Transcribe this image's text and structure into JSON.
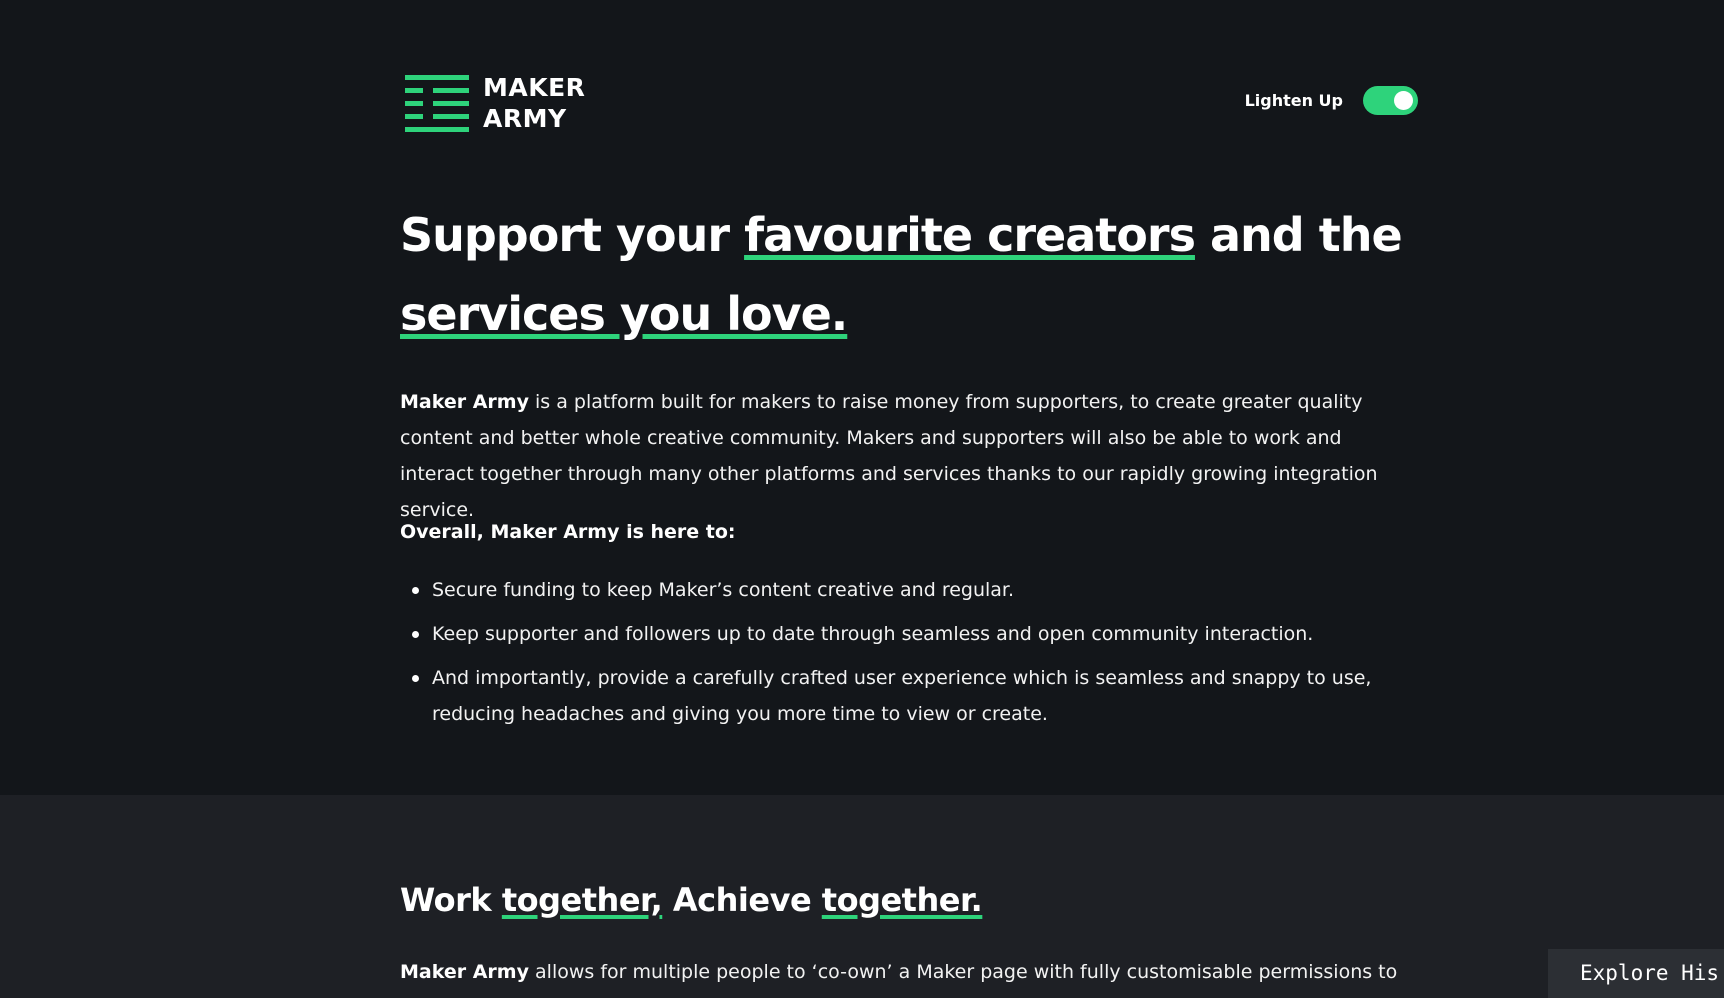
{
  "header": {
    "logo_line1": "MAKER",
    "logo_line2": "ARMY",
    "toggle_label": "Lighten Up",
    "toggle_on": true
  },
  "hero": {
    "headline_part1": "Support your ",
    "headline_highlight1": "favourite creators",
    "headline_part2": " and the ",
    "headline_highlight2": "services you love.",
    "intro_bold": "Maker Army",
    "intro_rest": " is a platform built for makers to raise money from supporters, to create greater quality content and better whole creative community. Makers and supporters will also be able to work and interact together through many other platforms and services thanks to our rapidly growing integration service.",
    "overall_heading": "Overall, Maker Army is here to:",
    "bullets": [
      "Secure funding to keep Maker’s content creative and regular.",
      "Keep supporter and followers up to date through seamless and open community interaction.",
      "And importantly, provide a carefully crafted user experience which is seamless and snappy to use, reducing headaches and giving you more time to view or create."
    ]
  },
  "section2": {
    "title_part1": "Work ",
    "title_highlight1": "together,",
    "title_part2": " Achieve ",
    "title_highlight2": "together.",
    "text_bold": "Maker Army",
    "text_rest": " allows for multiple people to ‘co-own’ a Maker page with fully customisable permissions to"
  },
  "explore_button": "Explore His",
  "colors": {
    "accent": "#2ed37b",
    "background_top": "#13161a",
    "background_bottom": "#1e2025",
    "text": "#ffffff"
  }
}
